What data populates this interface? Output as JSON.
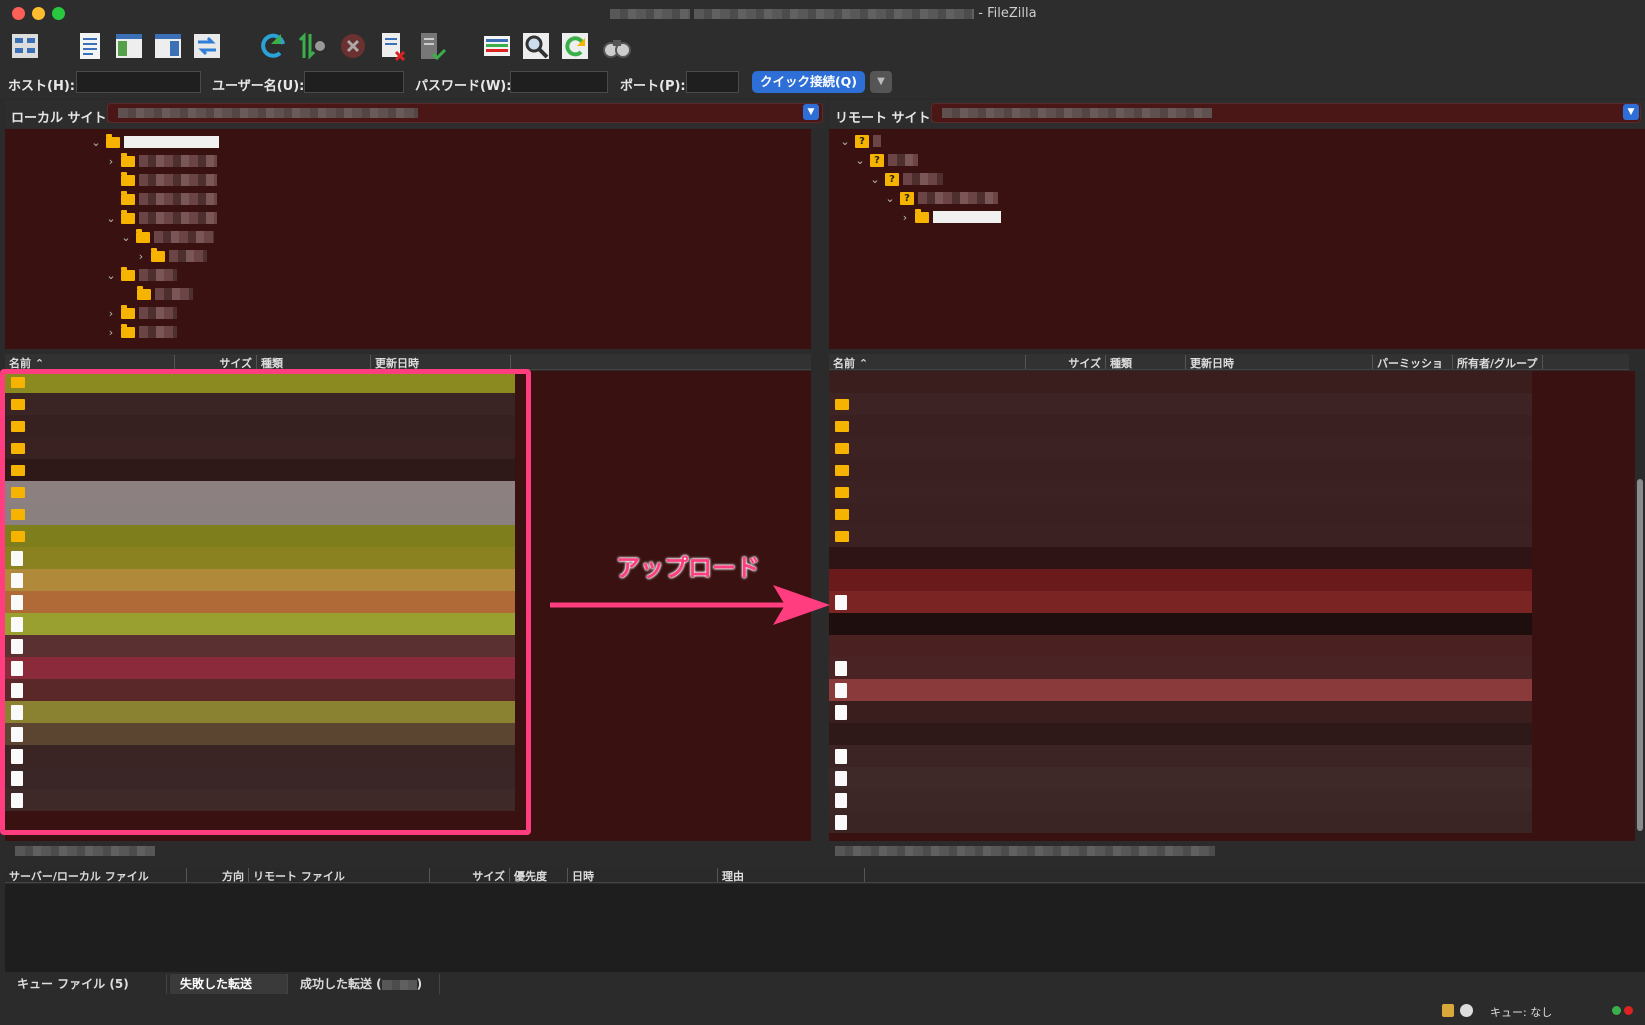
{
  "window": {
    "title": "- FileZilla"
  },
  "toolbar": {
    "icons": [
      "site-manager-icon",
      "log-toggle-icon",
      "local-tree-toggle-icon",
      "remote-tree-toggle-icon",
      "transfer-queue-icon",
      "refresh-icon",
      "process-queue-icon",
      "cancel-icon",
      "disconnect-icon",
      "reconnect-icon",
      "filter-icon",
      "compare-icon",
      "sync-browse-icon",
      "search-icon"
    ]
  },
  "quickconnect": {
    "host_label": "ホスト(H):",
    "user_label": "ユーザー名(U):",
    "pass_label": "パスワード(W):",
    "port_label": "ポート(P):",
    "connect_label": "クイック接続(Q)",
    "dropdown_glyph": "▼"
  },
  "local": {
    "site_label": "ローカル サイト:",
    "columns": {
      "name": "名前",
      "size": "サイズ",
      "type": "種類",
      "modified": "更新日時"
    }
  },
  "remote": {
    "site_label": "リモート サイト:",
    "columns": {
      "name": "名前",
      "size": "サイズ",
      "type": "種類",
      "modified": "更新日時",
      "permission": "パーミッション",
      "owner": "所有者/グループ"
    }
  },
  "annotation": {
    "text": "アップロード",
    "color": "#ff3d7f"
  },
  "queue": {
    "columns": {
      "server_local": "サーバー/ローカル ファイル",
      "direction": "方向",
      "remote_file": "リモート ファイル",
      "size": "サイズ",
      "priority": "優先度",
      "time": "日時",
      "reason": "理由"
    },
    "tabs": {
      "queued": "キュー ファイル (",
      "queued_count": "5",
      "queued_close": ")",
      "failed": "失敗した転送",
      "success": "成功した転送 (",
      "success_close": ")"
    }
  },
  "statusbar": {
    "queue_text": "キュー: なし"
  },
  "colors": {
    "accent": "#2d6fd6",
    "pane_bg": "#3a1111",
    "folder": "#f6b400",
    "highlight": "#ff3d7f"
  }
}
